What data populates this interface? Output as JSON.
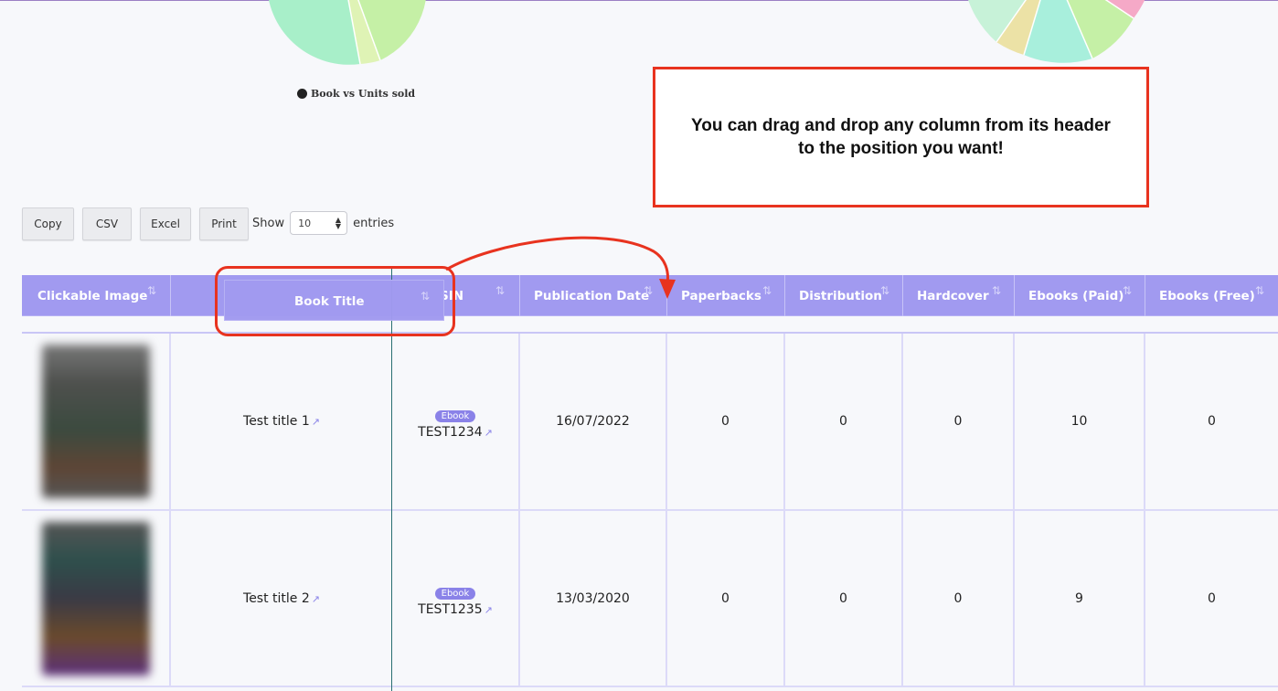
{
  "charts": {
    "left_legend": "Book vs Units sold"
  },
  "callout": {
    "line1": "You can drag and drop any column from its header",
    "line2": "to the position you want!"
  },
  "toolbar": {
    "buttons": [
      "Copy",
      "CSV",
      "Excel",
      "Print"
    ],
    "show_label": "Show",
    "entries_value": "10",
    "entries_label": "entries"
  },
  "table": {
    "columns": [
      "Clickable Image",
      "",
      "SIN",
      "Publication Date",
      "Paperbacks",
      "Distribution",
      "Hardcover",
      "Ebooks (Paid)",
      "Ebooks (Free)"
    ],
    "dragged_column": "Book Title",
    "sort_glyph": "⇅",
    "rows": [
      {
        "title": "Test title 1",
        "badge": "Ebook",
        "asin": "TEST1234",
        "publication_date": "16/07/2022",
        "paperbacks": "0",
        "distribution": "0",
        "hardcover": "0",
        "ebooks_paid": "10",
        "ebooks_free": "0"
      },
      {
        "title": "Test title 2",
        "badge": "Ebook",
        "asin": "TEST1235",
        "publication_date": "13/03/2020",
        "paperbacks": "0",
        "distribution": "0",
        "hardcover": "0",
        "ebooks_paid": "9",
        "ebooks_free": "0"
      }
    ]
  },
  "colors": {
    "header_bg": "#a19af0",
    "callout_border": "#e8331f",
    "badge_bg": "#8a82e8"
  }
}
